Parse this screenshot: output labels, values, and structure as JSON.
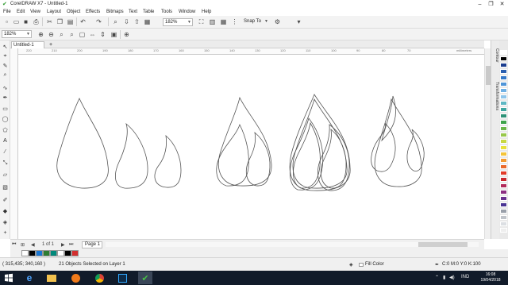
{
  "window": {
    "title": "CorelDRAW X7 - Untitled-1",
    "controls": [
      "–",
      "❐",
      "✕"
    ]
  },
  "menu": [
    "File",
    "Edit",
    "View",
    "Layout",
    "Object",
    "Effects",
    "Bitmaps",
    "Text",
    "Table",
    "Tools",
    "Window",
    "Help"
  ],
  "standard_toolbar": {
    "zoom_level": "182%",
    "snap_to_label": "Snap To"
  },
  "property_bar": {
    "zoom_level": "182%"
  },
  "document_tab": {
    "name": "Untitled-1",
    "add_label": "+"
  },
  "ruler": {
    "labels": [
      "220",
      "210",
      "200",
      "190",
      "180",
      "170",
      "160",
      "150",
      "140",
      "130",
      "120",
      "110",
      "100",
      "90",
      "80",
      "70"
    ],
    "unit": "millimeters"
  },
  "dockers": [
    "Contour",
    "Transformations"
  ],
  "page_navigator": {
    "page_counter": "1 of 1",
    "page_tab": "Page 1"
  },
  "status": {
    "cursor_position": "( 315,435; 340,160 )",
    "selection_info": "21 Objects Selected on Layer 1",
    "fill_label": "Fill Color",
    "outline_label": "C:0 M:0 Y:0 K:100"
  },
  "taskbar": {
    "language": "IND",
    "time": "16:08",
    "date": "19/04/2018"
  },
  "colors": {
    "palette": [
      "#ffffff",
      "#000000",
      "#1b3d8f",
      "#2a5fb0",
      "#3478c8",
      "#4f95d8",
      "#6fb0e4",
      "#8fc6ec",
      "#5fb8c4",
      "#3fa6a0",
      "#2c9277",
      "#3ea34c",
      "#6bb64a",
      "#98c84a",
      "#c8d844",
      "#e8e03c",
      "#f4c43a",
      "#f29a32",
      "#ea6a2c",
      "#e23c2a",
      "#c8282e",
      "#b22a5a",
      "#8c2e82",
      "#6a3290",
      "#4a3494",
      "#9aa0aa",
      "#c0c4ca",
      "#dcdfe3",
      "#eeeeee"
    ],
    "doc_palette": [
      "#ffffff",
      "#000000",
      "#1976d2",
      "#2e7d32",
      "#00897b",
      "#ffffff",
      "#000000",
      "#d32f2f"
    ]
  }
}
